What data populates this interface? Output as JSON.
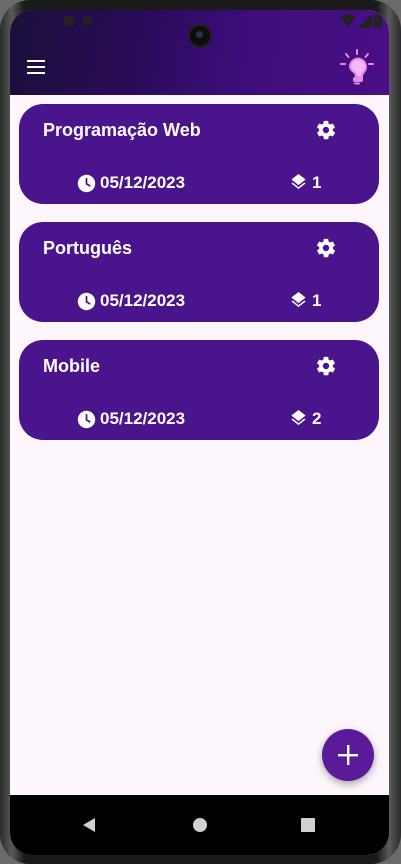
{
  "app": {
    "brand_colors": {
      "primary": "#4a148c",
      "appbar_end": "#4a0f86",
      "background": "#fdf7fd"
    }
  },
  "header": {
    "menu_icon": "hamburger-menu-icon",
    "logo_icon": "lightbulb-logo-icon"
  },
  "subjects": [
    {
      "title": "Programação Web",
      "date": "05/12/2023",
      "count": "1"
    },
    {
      "title": "Português",
      "date": "05/12/2023",
      "count": "1"
    },
    {
      "title": "Mobile",
      "date": "05/12/2023",
      "count": "2"
    }
  ],
  "fab": {
    "icon": "plus-icon"
  },
  "navigation": {
    "icons": [
      "back-icon",
      "home-icon",
      "recents-icon"
    ]
  }
}
